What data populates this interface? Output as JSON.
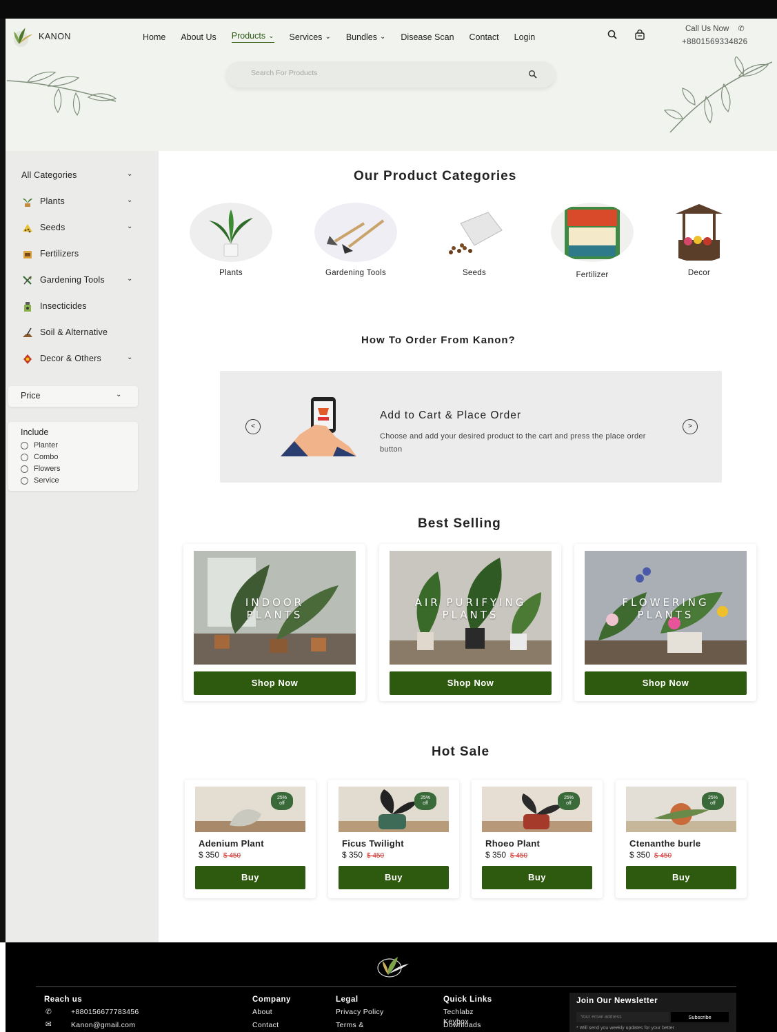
{
  "header": {
    "brand": "KANON",
    "nav": [
      {
        "label": "Home",
        "has_menu": false
      },
      {
        "label": "About Us",
        "has_menu": false
      },
      {
        "label": "Products",
        "has_menu": true,
        "active": true
      },
      {
        "label": "Services",
        "has_menu": true
      },
      {
        "label": "Bundles",
        "has_menu": true
      },
      {
        "label": "Disease Scan",
        "has_menu": false
      },
      {
        "label": "Contact",
        "has_menu": false
      },
      {
        "label": "Login",
        "has_menu": false
      }
    ],
    "call_label": "Call Us Now",
    "phone": "+8801569334826",
    "search_placeholder": "Search For Products"
  },
  "sidebar": {
    "categories": [
      {
        "label": "All Categories",
        "icon": "none",
        "has_menu": true
      },
      {
        "label": "Plants",
        "icon": "plant-icon",
        "has_menu": true
      },
      {
        "label": "Seeds",
        "icon": "seeds-icon",
        "has_menu": true
      },
      {
        "label": "Fertilizers",
        "icon": "fertilizer-icon",
        "has_menu": false
      },
      {
        "label": "Gardening Tools",
        "icon": "tools-icon",
        "has_menu": true
      },
      {
        "label": "Insecticides",
        "icon": "insecticide-icon",
        "has_menu": false
      },
      {
        "label": "Soil & Alternative",
        "icon": "soil-icon",
        "has_menu": false
      },
      {
        "label": "Decor & Others",
        "icon": "decor-icon",
        "has_menu": true
      }
    ],
    "price_label": "Price",
    "include_title": "Include",
    "include_options": [
      "Planter",
      "Combo",
      "Flowers",
      "Service"
    ]
  },
  "main": {
    "categories_title": "Our Product Categories",
    "product_categories": [
      "Plants",
      "Gardening Tools",
      "Seeds",
      "Fertilizer",
      "Decor"
    ],
    "howto_title": "How To Order From Kanon?",
    "howto_step_title": "Add to Cart & Place Order",
    "howto_step_text": "Choose and add your desired product to the cart and press the place order button",
    "best_selling_title": "Best Selling",
    "best_selling": [
      {
        "caption_line1": "INDOOR",
        "caption_line2": "PLANTS",
        "button": "Shop Now"
      },
      {
        "caption_line1": "AIR PURIFYING",
        "caption_line2": "PLANTS",
        "button": "Shop Now"
      },
      {
        "caption_line1": "FLOWERING",
        "caption_line2": "PLANTS",
        "button": "Shop Now"
      }
    ],
    "hot_sale_title": "Hot Sale",
    "hot_sale": [
      {
        "name": "Adenium Plant",
        "price": "$ 350",
        "old_price": "$ 450",
        "badge_top": "25%",
        "badge_bottom": "off",
        "button": "Buy"
      },
      {
        "name": "Ficus Twilight",
        "price": "$ 350",
        "old_price": "$ 450",
        "badge_top": "25%",
        "badge_bottom": "off",
        "button": "Buy"
      },
      {
        "name": "Rhoeo Plant",
        "price": "$ 350",
        "old_price": "$ 450",
        "badge_top": "25%",
        "badge_bottom": "off",
        "button": "Buy"
      },
      {
        "name": "Ctenanthe burle",
        "price": "$ 350",
        "old_price": "$ 450",
        "badge_top": "25%",
        "badge_bottom": "off",
        "button": "Buy"
      }
    ]
  },
  "footer": {
    "reach_title": "Reach us",
    "reach_phone": "+880156677783456",
    "reach_email": "Kanon@gmail.com",
    "company_title": "Company",
    "company_links": [
      "About",
      "Contact"
    ],
    "legal_title": "Legal",
    "legal_links": [
      "Privacy Policy",
      "Terms &"
    ],
    "quick_title": "Quick Links",
    "quick_links": [
      "Techlabz",
      "Keybox",
      "Downloads"
    ],
    "newsletter_title": "Join Our Newsletter",
    "newsletter_placeholder": "Your email address",
    "newsletter_button": "Subscribe",
    "newsletter_note": "* Will send you weekly updates for your better"
  },
  "colors": {
    "accent": "#2d5a0e",
    "header_bg": "#f1f3ef",
    "sidebar_bg": "#ebecea",
    "footer_bg": "#000000",
    "strike": "#d03030"
  }
}
